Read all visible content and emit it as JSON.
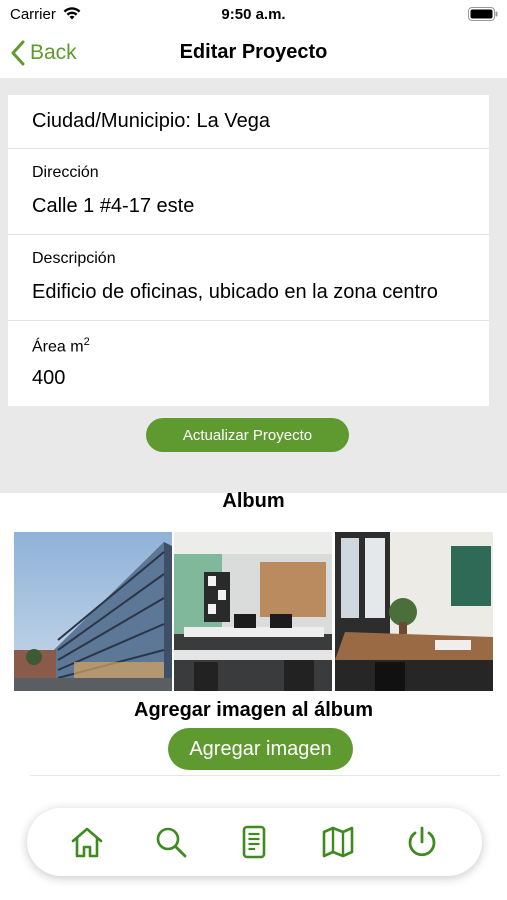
{
  "status_bar": {
    "carrier": "Carrier",
    "time": "9:50 a.m."
  },
  "nav": {
    "back_label": "Back",
    "title": "Editar Proyecto"
  },
  "form": {
    "city": "Ciudad/Municipio: La Vega",
    "address_label": "Dirección",
    "address_value": "Calle 1 #4-17 este",
    "description_label": "Descripción",
    "description_value": "Edificio de oficinas, ubicado en la zona centro",
    "area_label": "Área m",
    "area_unit_sup": "2",
    "area_value": "400",
    "update_button": "Actualizar Proyecto"
  },
  "album": {
    "title": "Album",
    "images": [
      "building-exterior",
      "office-interior",
      "meeting-room"
    ],
    "add_label": "Agregar imagen al álbum",
    "add_button": "Agregar imagen"
  },
  "tab_bar": {
    "items": [
      "home-icon",
      "search-icon",
      "document-icon",
      "map-icon",
      "power-icon"
    ]
  },
  "colors": {
    "accent": "#5e9a30",
    "background_grey": "#e9e9e9"
  }
}
